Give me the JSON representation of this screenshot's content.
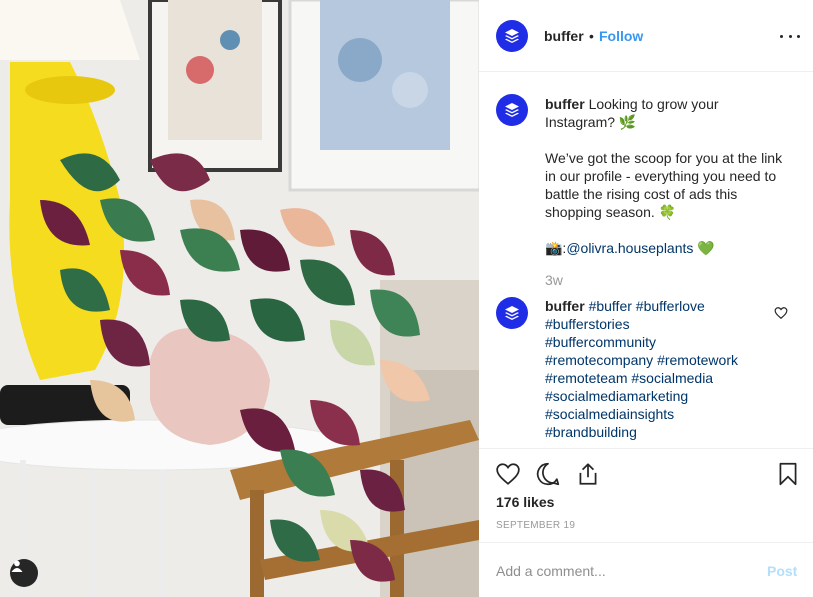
{
  "post": {
    "username": "buffer",
    "separator": "•",
    "follow_label": "Follow",
    "caption_text": "Looking to grow your Instagram? 🌿",
    "caption_para2": "We’ve got the scoop for you at the link in our profile - everything you need to battle the rising cost of ads this shopping season. 🍀",
    "caption_credit_emoji": "📸:",
    "caption_mention": "@olivra.houseplants",
    "caption_credit_suffix": " 💚",
    "time_ago": "3w",
    "hashtag_comment": {
      "username": "buffer",
      "tags": [
        "#buffer",
        "#bufferlove",
        "#bufferstories",
        "#buffercommunity",
        "#remotecompany",
        "#remotework",
        "#remoteteam",
        "#socialmedia",
        "#socialmediamarketing",
        "#socialmediainsights",
        "#brandbuilding"
      ]
    },
    "likes_text": "176 likes",
    "date_text": "SEPTEMBER 19",
    "comment_placeholder": "Add a comment...",
    "post_button_label": "Post"
  },
  "icons": {
    "avatar": "buffer-logo-icon",
    "more": "more-horizontal-icon",
    "like": "heart-icon",
    "comment": "comment-bubble-icon",
    "share": "share-icon",
    "save": "bookmark-icon",
    "user_tag": "user-tag-icon"
  },
  "colors": {
    "brand": "#1f2ee6",
    "link": "#3897f0",
    "hashtag": "#003569",
    "muted": "#999999",
    "post_disabled": "#b2dffc",
    "lamp": "#f5dc1e"
  }
}
